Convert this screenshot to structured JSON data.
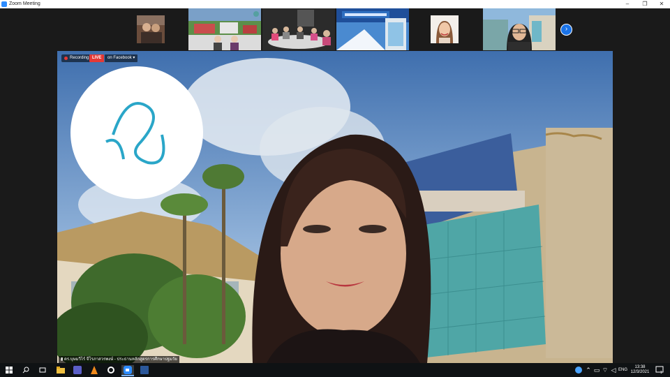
{
  "window": {
    "title": "Zoom Meeting",
    "minimize": "–",
    "restore": "❐",
    "close": "✕"
  },
  "meeting": {
    "recording_label": "Recording",
    "live_label": "LIVE",
    "live_target": "on Facebook",
    "live_caret": "▾",
    "speaker_name": "ดร.บุษมวิไร์ จีโรภาสวรพงษ์ - ประธานหลักสูตรการศึกษาปฐมวัย",
    "next_page": "›"
  },
  "taskbar": {
    "lang": "ENG",
    "time": "13:38",
    "date": "12/3/2021",
    "notification_count": "1"
  },
  "colors": {
    "live_red": "#e53935",
    "zoom_blue": "#2d8cff",
    "taskbar": "#0f1214"
  }
}
